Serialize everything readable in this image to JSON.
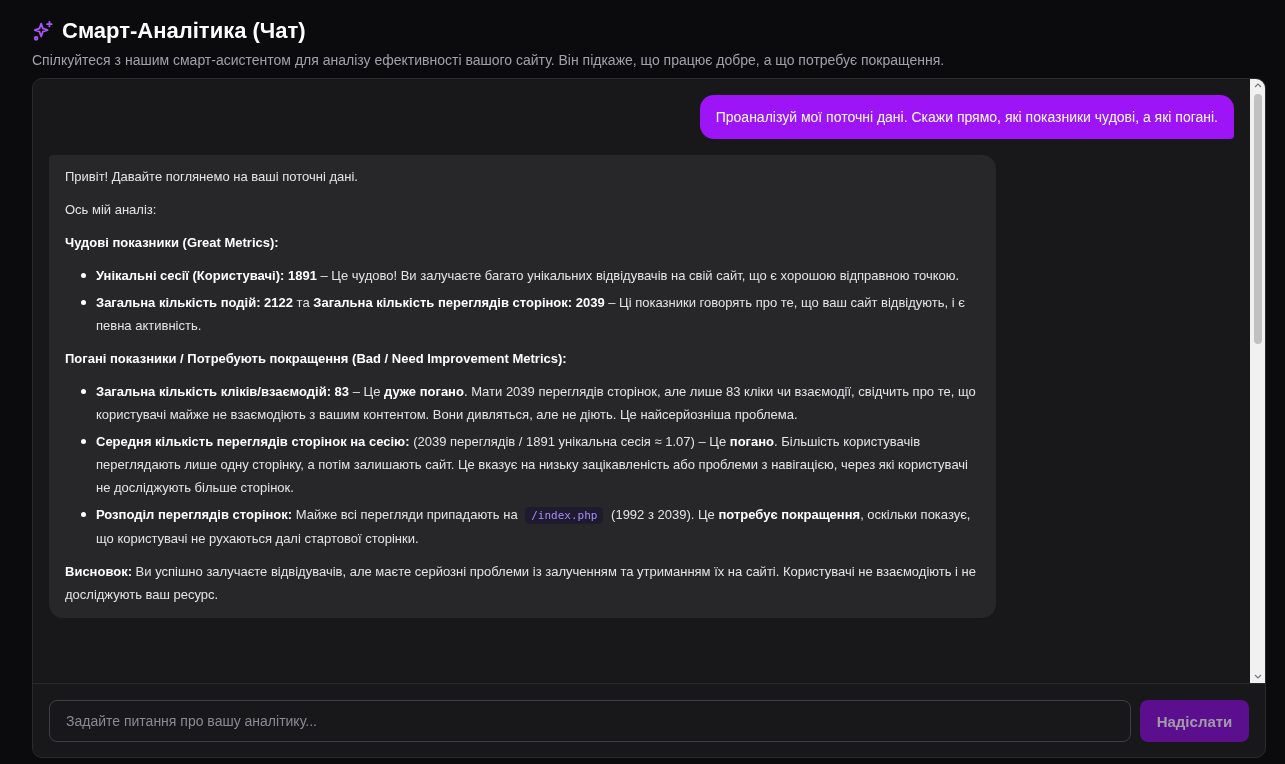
{
  "header": {
    "title": "Смарт-Аналітика (Чат)",
    "subtitle": "Спілкуйтеся з нашим смарт-асистентом для аналізу ефективності вашого сайту. Він підкаже, що працює добре, а що потребує покращення."
  },
  "messages": [
    {
      "from_user": true,
      "blocks": [
        {
          "kind": "paragraph",
          "text": "Проаналізуй мої поточні дані. Скажи прямо, які показники чудові, а які погані."
        }
      ]
    },
    {
      "from_user": false,
      "blocks": [
        {
          "kind": "paragraph",
          "text": "Привіт! Давайте поглянемо на ваші поточні дані."
        },
        {
          "kind": "paragraph",
          "text": "Ось мій аналіз:"
        },
        {
          "kind": "heading",
          "text": "Чудові показники (Great Metrics):"
        },
        {
          "kind": "list",
          "items": [
            [
              {
                "kind": "text",
                "text": "**Унікальні сесії (Користувачі): 1891** – Це чудово! Ви залучаєте багато унікальних відвідувачів на свій сайт, що є хорошою відправною точкою."
              }
            ],
            [
              {
                "kind": "text",
                "text": "**Загальна кількість подій: 2122** та **Загальна кількість переглядів сторінок: 2039** – Ці показники говорять про те, що ваш сайт відвідують, і є певна активність."
              }
            ]
          ]
        },
        {
          "kind": "heading",
          "text": "Погані показники / Потребують покращення (Bad / Need Improvement Metrics):"
        },
        {
          "kind": "list",
          "items": [
            [
              {
                "kind": "text",
                "text": "**Загальна кількість кліків/взаємодій: 83** – Це **дуже погано**. Мати 2039 переглядів сторінок, але лише 83 кліки чи взаємодії, свідчить про те, що користувачі майже не взаємодіють з вашим контентом. Вони дивляться, але не діють. Це найсерйозніша проблема."
              }
            ],
            [
              {
                "kind": "text",
                "text": "**Середня кількість переглядів сторінок на сесію:** (2039 переглядів / 1891 унікальна сесія ≈ 1.07) – Це **погано**. Більшість користувачів переглядають лише одну сторінку, а потім залишають сайт. Це вказує на низьку зацікавленість або проблеми з навігацією, через які користувачі не досліджують більше сторінок."
              }
            ],
            [
              {
                "kind": "text",
                "text": "**Розподіл переглядів сторінок:** Майже всі перегляди припадають на "
              },
              {
                "kind": "code",
                "text": "/index.php"
              },
              {
                "kind": "text",
                "text": " (1992 з 2039). Це **потребує покращення**, оскільки показує, що користувачі не рухаються далі стартової сторінки."
              }
            ]
          ]
        },
        {
          "kind": "paragraph",
          "text": "**Висновок:** Ви успішно залучаєте відвідувачів, але маєте серйозні проблеми із залученням та утриманням їх на сайті. Користувачі не взаємодіють і не досліджують ваш ресурс."
        }
      ]
    }
  ],
  "composer": {
    "placeholder": "Задайте питання про вашу аналітику...",
    "send_button": {
      "label": "Надіслати",
      "disabled": true
    }
  }
}
